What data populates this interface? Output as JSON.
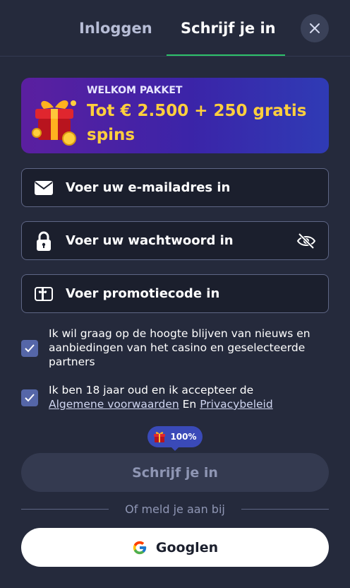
{
  "header": {
    "tabs": [
      {
        "label": "Inloggen",
        "active": false
      },
      {
        "label": "Schrijf je in",
        "active": true
      }
    ],
    "close_icon": "close-icon"
  },
  "banner": {
    "kicker": "WELKOM PAKKET",
    "title": "Tot € 2.500 + 250 gratis spins",
    "icon": "gift-icon"
  },
  "form": {
    "email": {
      "placeholder": "Voer uw e-mailadres in",
      "value": "",
      "icon": "envelope-icon"
    },
    "password": {
      "placeholder": "Voer uw wachtwoord in",
      "value": "",
      "icon": "lock-icon",
      "toggle_icon": "eye-off-icon"
    },
    "promo": {
      "placeholder": "Voer promotiecode in",
      "value": "",
      "icon": "gift-card-icon"
    }
  },
  "consents": {
    "newsletter": {
      "checked": true,
      "text": "Ik wil graag op de hoogte blijven van nieuws en aanbiedingen van het casino en geselecteerde partners"
    },
    "terms": {
      "checked": true,
      "prefix": "Ik ben 18 jaar oud en ik accepteer de",
      "terms_link": "Algemene voorwaarden",
      "joiner": "En",
      "privacy_link": "Privacybeleid"
    }
  },
  "progress_badge": {
    "label": "100%",
    "value": 100
  },
  "submit_label": "Schrijf je in",
  "divider_text": "Of meld je aan bij",
  "google_button": {
    "label": "Googlen",
    "icon": "google-icon"
  },
  "colors": {
    "background": "#252a3c",
    "accent_underline": "#2ec16a",
    "banner_title": "#ffcf3d",
    "checkbox": "#5566a8",
    "badge": "#3a4ab8"
  }
}
